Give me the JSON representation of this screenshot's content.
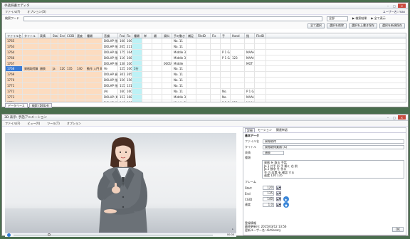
{
  "top": {
    "title": "手話辞書エディタ",
    "menu": [
      "ファイル(F)",
      "オプション(O)"
    ],
    "user": "ユーザー名: mao",
    "search_label": "検索ワード",
    "search_value": "",
    "filter_value": "全部",
    "mode_btn": "▶ 検索結果",
    "mode_btn2": "▶ 全て表示",
    "actions": [
      "全て選択",
      "選択を削除",
      "選択を上書き保存",
      "選択を新規保存"
    ],
    "columns": [
      "ファイル名",
      "タイトル",
      "表情",
      "Start",
      "End",
      "CGID",
      "速度",
      "種類",
      "音韻",
      "Frame",
      "Fix",
      "種類",
      "単",
      "類",
      "資料",
      "手の動き",
      "補足",
      "FileID",
      "Fix",
      "手",
      "Hand",
      "指",
      "FileID"
    ],
    "rows": [
      {
        "id": "1765",
        "c8": "DOLHP 指文字(A)",
        "c9": "108",
        "c10": "106",
        "c15": "No. 11",
        "c19": "",
        "c20": "",
        "c21": ""
      },
      {
        "id": "1763",
        "c8": "DOLHP 指文字 (B)",
        "c9": "205",
        "c10": "211",
        "c15": "No. 11",
        "c19": "",
        "c20": "",
        "c21": ""
      },
      {
        "id": "1764",
        "c8": "DOLHP 指文字 (C)",
        "c9": "175",
        "c10": "164",
        "c15": "Middle 3x2",
        "c19": "P 1 GANE",
        "c20": "",
        "c21": "MAAHN 05"
      },
      {
        "id": "1766",
        "c8": "DOLHP 指文字 (D)",
        "c9": "116",
        "c10": "108",
        "c15": "Middle 3x2",
        "c19": "P 1 GANE",
        "c20": "123",
        "c21": "MAAHN 05"
      },
      {
        "id": "1767",
        "c8": "DOLHP 指文字 (E)",
        "c9": "138",
        "c10": "106",
        "c14": "0001984",
        "c15": "Middle",
        "c19": "",
        "c20": "",
        "c21": "MOT"
      },
      {
        "id": "1768",
        "c1": "資格取得業務 (G)",
        "c2": "顔表",
        "c3": "Ja",
        "c4": "120",
        "c5": "135",
        "c6": "140",
        "c7": "動作 入門 8 4 (手の 形) 数字 X,X,X 4",
        "c8": "Ve",
        "c9": "125",
        "c10": "106",
        "c11": "1行",
        "c15": "No. 11",
        "selected": true
      },
      {
        "id": "1769",
        "c8": "DOLHP 資格取得",
        "c9": "301",
        "c10": "265",
        "c15": "No. 11"
      },
      {
        "id": "1770",
        "c8": "DOLHP 指文字 (H)",
        "c9": "156",
        "c10": "156",
        "c15": "No. 11"
      },
      {
        "id": "1771",
        "c8": "DOLHP 指文字 (I)",
        "c9": "115",
        "c10": "131",
        "c15": "No. 11"
      },
      {
        "id": "1772",
        "c8": "(A)",
        "c9": "160",
        "c10": "160",
        "c15": "No. 11",
        "c18": "",
        "c19": "No.",
        "c21": "P 1 GANE 1 部"
      },
      {
        "id": "1773",
        "c8": "DOLHP (K)",
        "c9": "153",
        "c10": "168",
        "c15": "Middle 3x2",
        "c19": "No.",
        "c21": "MAAHN 05"
      },
      {
        "id": "1774",
        "c8": "DOLHP 指文字 (L)",
        "c9": "149",
        "c10": "118",
        "c15": "Middle 3x2",
        "c19": "P 1 GANE",
        "c20": "123",
        "c21": "MAAHN 05"
      },
      {
        "id": "1775",
        "c8": "DOLHP 指文字 (M)",
        "c9": "149",
        "c10": "145",
        "c14": "0001984",
        "c15": "Middle",
        "c21": "MOT"
      }
    ],
    "tabs": [
      "データベース",
      "検索 (DOLH)"
    ]
  },
  "bottom": {
    "title": "3D 表示: 手話アニメーション",
    "menu": [
      "ファイル(F)",
      "ビュー(V)",
      "ツール(T)",
      "オプション"
    ],
    "status": "▸ ",
    "panel_tabs": [
      "詳細",
      "モーション",
      "関連単語"
    ],
    "section": "基本データ",
    "fields": [
      {
        "label": "ファイル名",
        "value": "資格取得"
      },
      {
        "label": "タイトル",
        "value": "資格取得業務 (G)"
      },
      {
        "label": "表情",
        "value": "顔表"
      }
    ],
    "memo_label": "種類",
    "memo": [
      "資格 を 取る 手話",
      "Ja 1 片手 形 手 開く 右 前",
      "Ja 2 数字 を 作る",
      "手 の 位置 を 確認 する",
      "速度 120 135"
    ],
    "frame_section": "フレーム",
    "numbers": [
      {
        "label": "Start",
        "value": "120"
      },
      {
        "label": "End",
        "value": "135"
      },
      {
        "label": "CGID",
        "value": "140"
      },
      {
        "label": "速度",
        "value": "1.0"
      }
    ],
    "footer": [
      "登録情報",
      "最終更新日: 2015/03/12 13:56",
      "更新ユーザー名: dictionary"
    ],
    "ok_btn": "OK",
    "player_time": "00:00"
  }
}
